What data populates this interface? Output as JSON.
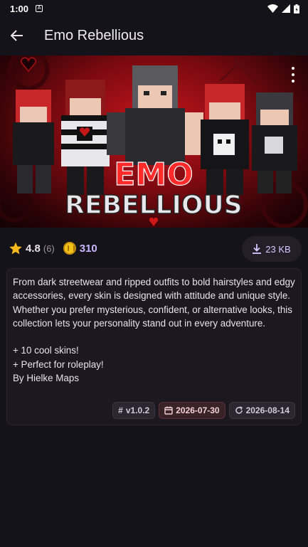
{
  "status": {
    "time": "1:00"
  },
  "appbar": {
    "title": "Emo Rebellious"
  },
  "hero": {
    "text_line1": "EMO",
    "text_line2": "REBELLIOUS"
  },
  "stats": {
    "rating": "4.8",
    "rating_count": "(6)",
    "price": "310",
    "size": "23 KB"
  },
  "description": "From dark streetwear and ripped outfits to bold hairstyles and edgy accessories, every skin is designed with attitude and unique style. Whether you prefer mysterious, confident, or alternative looks, this collection lets your personality stand out in every adventure.\n\n+ 10 cool skins!\n+ Perfect for roleplay!\nBy Hielke Maps",
  "tags": {
    "version": "v1.0.2",
    "created": "2026-07-30",
    "updated": "2026-08-14"
  },
  "colors": {
    "accent": "#c9b8ff",
    "star": "#f5b81c",
    "coin": "#f2c21b",
    "hero_red": "#c8141c"
  }
}
